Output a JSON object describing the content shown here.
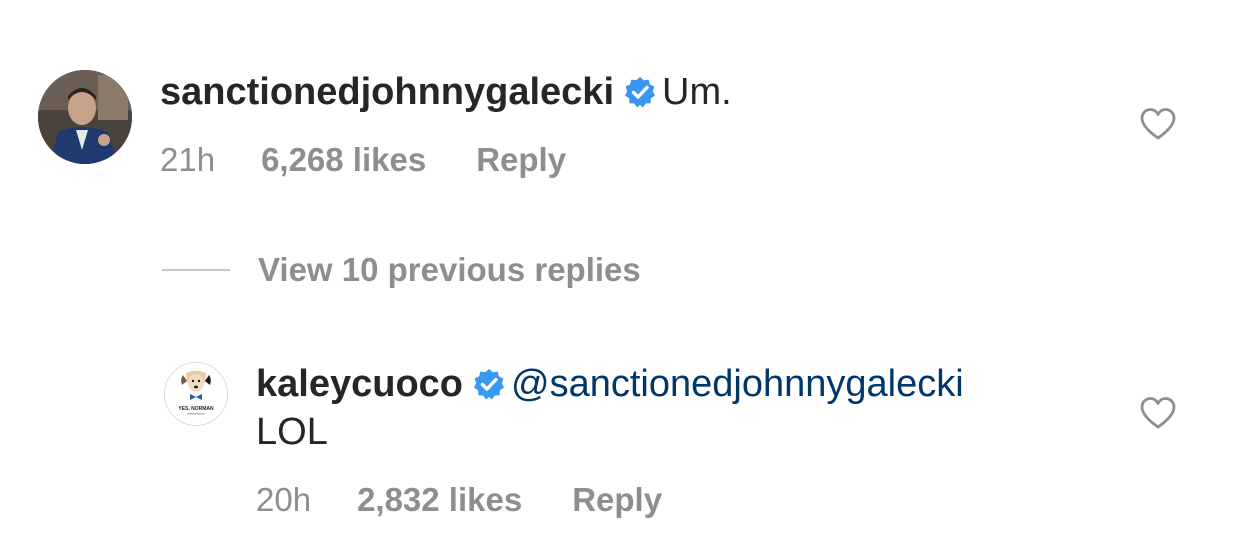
{
  "comments": [
    {
      "username": "sanctionedjohnnygalecki",
      "verified": true,
      "text": "Um.",
      "time": "21h",
      "likes": "6,268 likes",
      "reply_label": "Reply",
      "avatar_icon": "profile-photo-man-in-suit",
      "heart_icon": "heart-outline-icon"
    }
  ],
  "view_replies": {
    "label": "View 10 previous replies"
  },
  "replies": [
    {
      "username": "kaleycuoco",
      "verified": true,
      "mention": "@sanctionedjohnnygalecki",
      "text": "LOL",
      "time": "20h",
      "likes": "2,832 likes",
      "reply_label": "Reply",
      "avatar_text": "YES, NORMAN",
      "avatar_icon": "dog-bowtie-logo",
      "heart_icon": "heart-outline-icon"
    }
  ],
  "colors": {
    "text_primary": "#262626",
    "text_secondary": "#8e8e8e",
    "mention": "#00376b",
    "verified_badge": "#3897f0"
  }
}
